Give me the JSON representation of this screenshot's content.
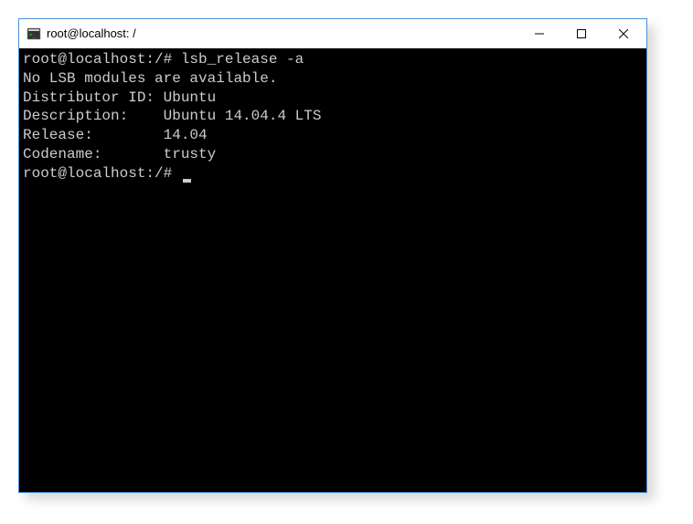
{
  "window": {
    "title": "root@localhost: /"
  },
  "terminal": {
    "lines": [
      "root@localhost:/# lsb_release -a",
      "No LSB modules are available.",
      "Distributor ID: Ubuntu",
      "Description:    Ubuntu 14.04.4 LTS",
      "Release:        14.04",
      "Codename:       trusty",
      "root@localhost:/# "
    ]
  }
}
